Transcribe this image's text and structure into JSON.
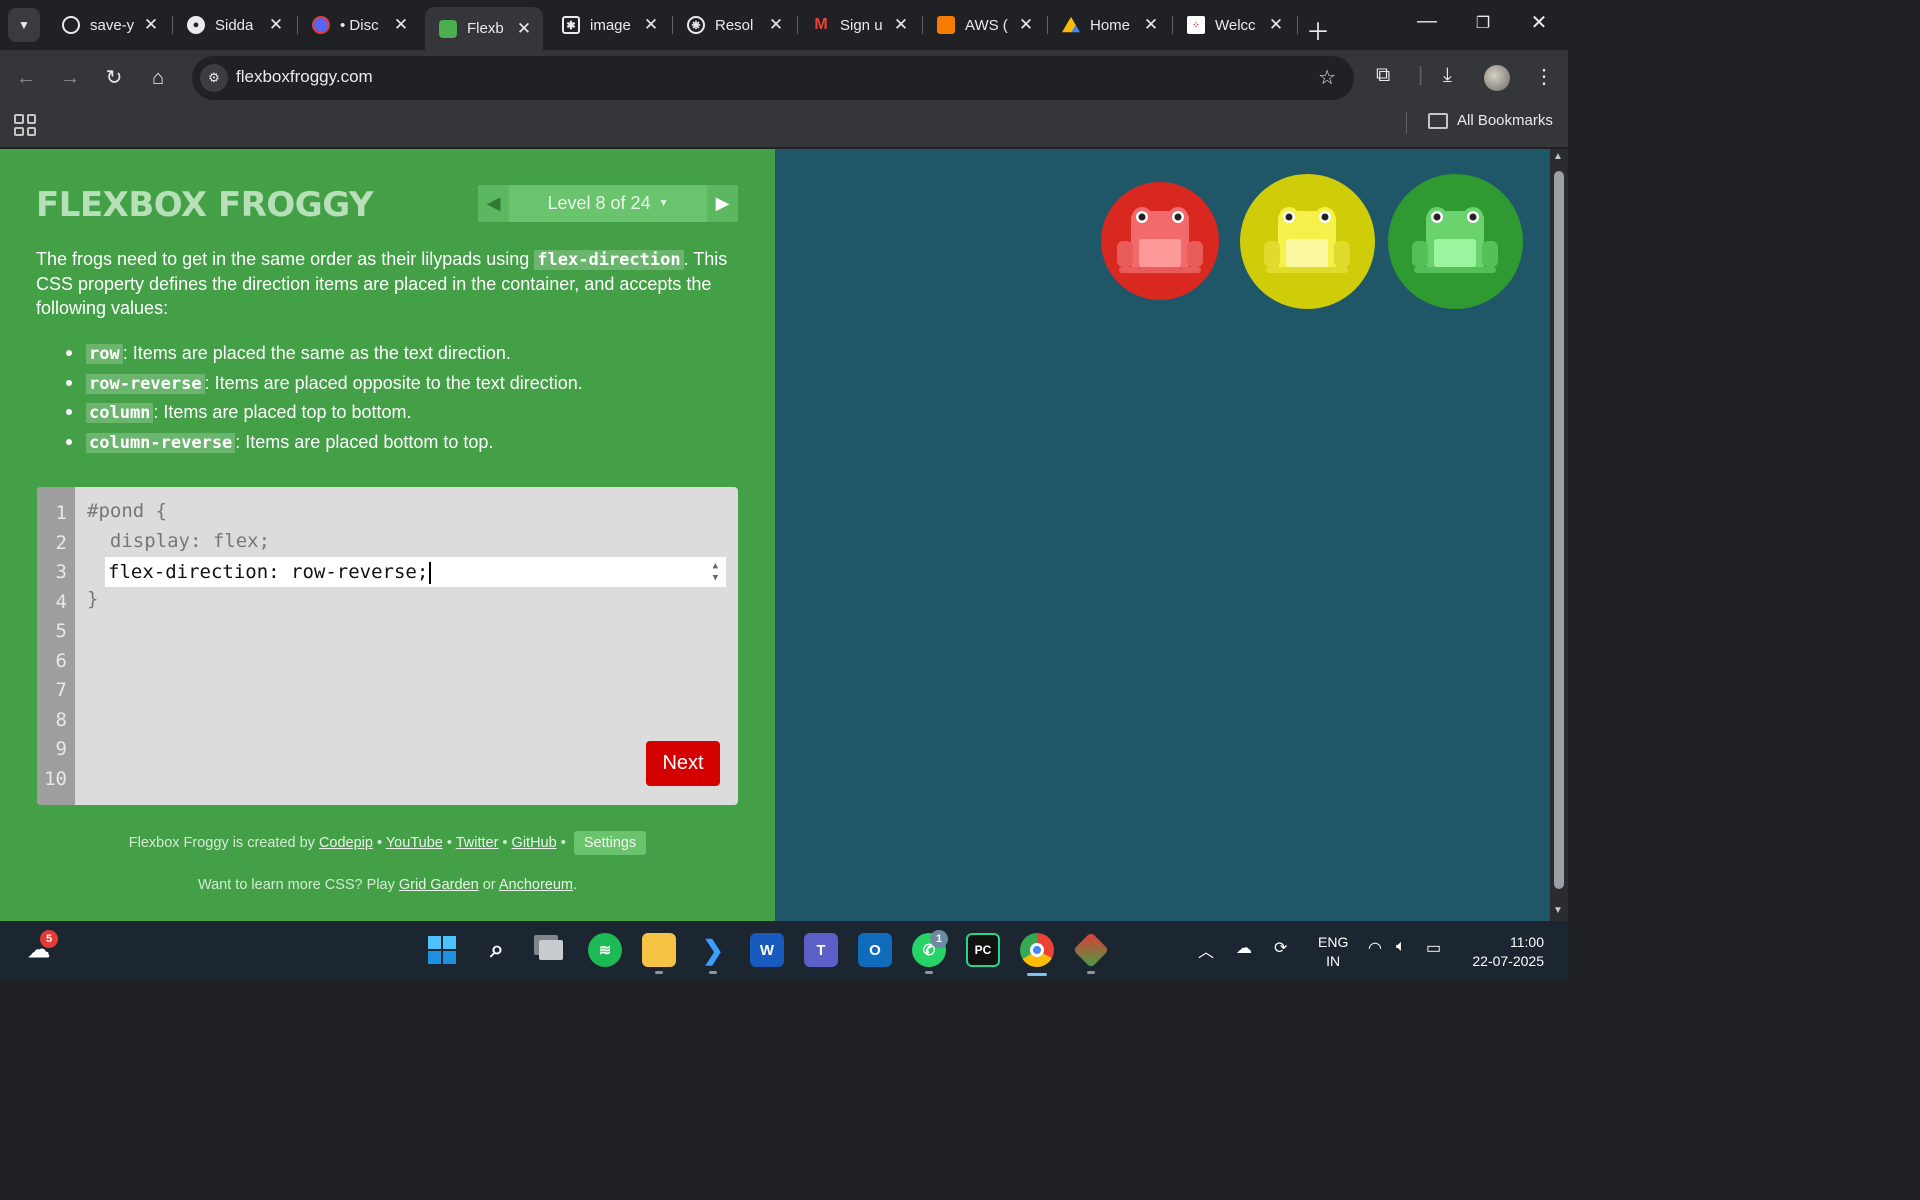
{
  "browser": {
    "tabs": [
      {
        "title": "save-y",
        "icon": "globe-icon"
      },
      {
        "title": "Sidda",
        "icon": "github-icon"
      },
      {
        "title": "• Disc",
        "icon": "discord-icon"
      },
      {
        "title": "Flexb",
        "icon": "frog-icon",
        "active": true
      },
      {
        "title": "image",
        "icon": "image-icon"
      },
      {
        "title": "Resol",
        "icon": "openai-icon"
      },
      {
        "title": "Sign u",
        "icon": "gmail-icon"
      },
      {
        "title": "AWS (",
        "icon": "aws-icon"
      },
      {
        "title": "Home",
        "icon": "drive-icon"
      },
      {
        "title": "Welcc",
        "icon": "site-icon"
      }
    ],
    "url": "flexboxfroggy.com",
    "bookmarks_all": "All Bookmarks"
  },
  "game": {
    "logo": "FLEXBOX FROGGY",
    "level_label": "Level 8 of 24",
    "intro_before": "The frogs need to get in the same order as their lilypads using ",
    "intro_code": "flex-direction",
    "intro_after": ". This CSS property defines the direction items are placed in the container, and accepts the following values:",
    "values": [
      {
        "code": "row",
        "desc": ": Items are placed the same as the text direction."
      },
      {
        "code": "row-reverse",
        "desc": ": Items are placed opposite to the text direction."
      },
      {
        "code": "column",
        "desc": ": Items are placed top to bottom."
      },
      {
        "code": "column-reverse",
        "desc": ": Items are placed bottom to top."
      }
    ],
    "editor": {
      "line_numbers": [
        "1",
        "2",
        "3",
        "4",
        "5",
        "6",
        "7",
        "8",
        "9",
        "10"
      ],
      "line1": "#pond {",
      "line2": "  display: flex;",
      "input_value": "flex-direction: row-reverse;",
      "line4": "}"
    },
    "next_label": "Next",
    "credits": {
      "prefix": "Flexbox Froggy is created by ",
      "codepip": "Codepip",
      "youtube": "YouTube",
      "twitter": "Twitter",
      "github": "GitHub",
      "settings": "Settings",
      "more_prefix": "Want to learn more CSS? Play ",
      "grid_garden": "Grid Garden",
      "or": " or ",
      "anchoreum": "Anchoreum",
      "period": "."
    },
    "pads": [
      {
        "color": "red",
        "hex": "#d8281f"
      },
      {
        "color": "yellow",
        "hex": "#cfcc0a"
      },
      {
        "color": "green",
        "hex": "#2f9a32"
      }
    ],
    "frogs": [
      {
        "color": "red",
        "hex": "#f26a6a"
      },
      {
        "color": "yellow",
        "hex": "#f5f04a"
      },
      {
        "color": "green",
        "hex": "#6ad36e"
      }
    ]
  },
  "taskbar": {
    "weather_badge": "5",
    "whatsapp_badge": "1",
    "lang_line1": "ENG",
    "lang_line2": "IN",
    "time": "11:00",
    "date": "22-07-2025"
  }
}
